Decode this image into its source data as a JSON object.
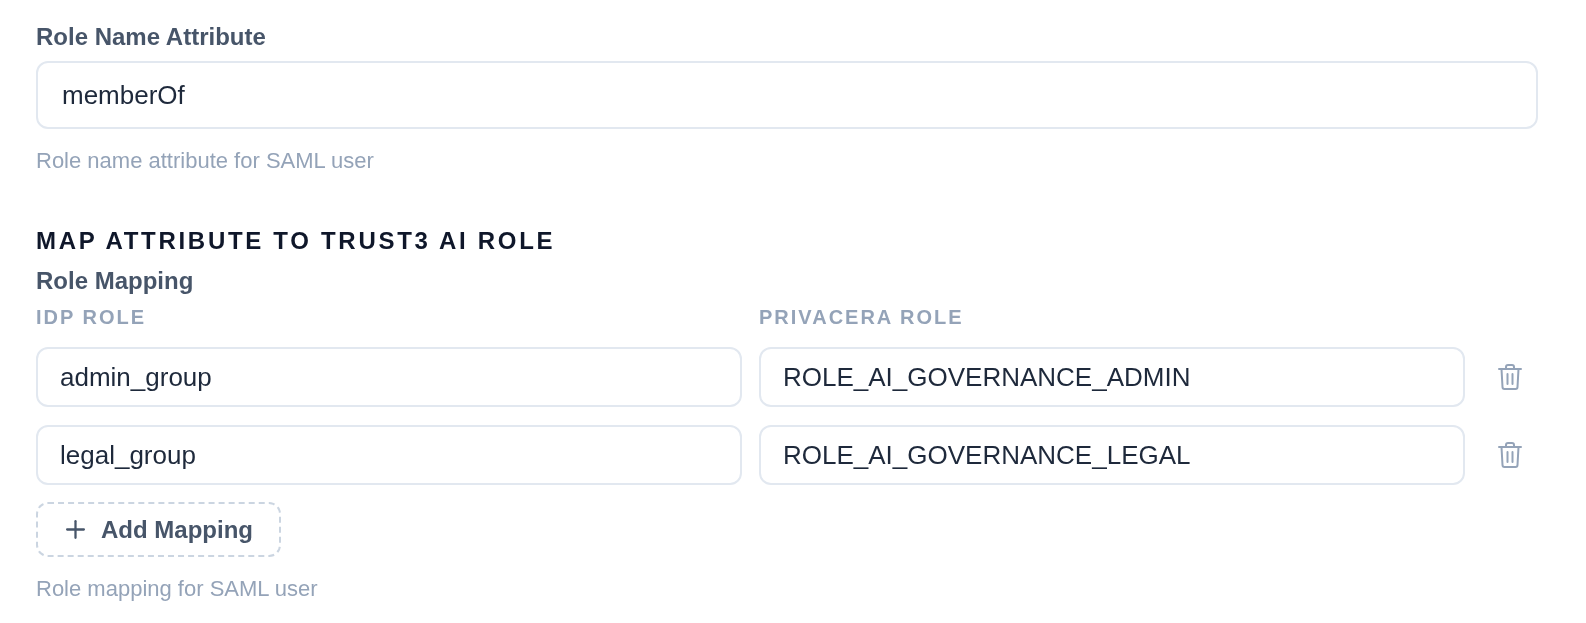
{
  "role_name_attribute": {
    "label": "Role Name Attribute",
    "value": "memberOf",
    "help": "Role name attribute for SAML user"
  },
  "section_title": "MAP ATTRIBUTE TO TRUST3 AI ROLE",
  "role_mapping": {
    "label": "Role Mapping",
    "columns": [
      "IDP ROLE",
      "PRIVACERA ROLE"
    ],
    "rows": [
      {
        "idp_role": "admin_group",
        "privacera_role": "ROLE_AI_GOVERNANCE_ADMIN"
      },
      {
        "idp_role": "legal_group",
        "privacera_role": "ROLE_AI_GOVERNANCE_LEGAL"
      }
    ],
    "add_button": "Add Mapping",
    "help": "Role mapping for SAML user"
  }
}
